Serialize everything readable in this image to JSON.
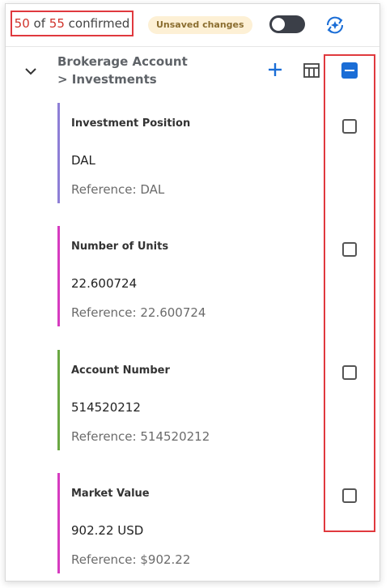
{
  "header": {
    "confirmed_count": "50",
    "of_text": "of",
    "total_count": "55",
    "confirmed_label": "confirmed",
    "unsaved_badge": "Unsaved changes"
  },
  "group": {
    "title_line1": "Brokerage Account",
    "title_line2": "> Investments"
  },
  "fields": [
    {
      "label": "Investment Position",
      "value": "DAL",
      "reference": "Reference: DAL",
      "accent": "#8e7fd6"
    },
    {
      "label": "Number of Units",
      "value": "22.600724",
      "reference": "Reference: 22.600724",
      "accent": "#d63cc0"
    },
    {
      "label": "Account Number",
      "value": "514520212",
      "reference": "Reference: 514520212",
      "accent": "#6aa843"
    },
    {
      "label": "Market Value",
      "value": "902.22 USD",
      "reference": "Reference: $902.22",
      "accent": "#d63cc0"
    }
  ],
  "colors": {
    "accent_blue": "#1a6dd6",
    "highlight_red": "#e0393e"
  }
}
